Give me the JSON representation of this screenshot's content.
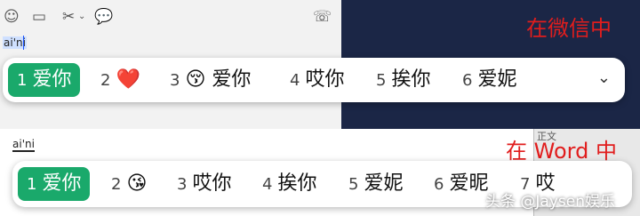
{
  "top_panel": {
    "label": "在微信中",
    "typed": "ai'ni",
    "toolbar_icons": [
      "emoji-icon",
      "folder-icon",
      "scissors-icon",
      "chat-bubble-icon",
      "phone-icon"
    ]
  },
  "ime_top": {
    "candidates": [
      {
        "num": "1",
        "text": "爱你"
      },
      {
        "num": "2",
        "text": "❤️"
      },
      {
        "num": "3",
        "text": "😚 爱你"
      },
      {
        "num": "4",
        "text": "哎你"
      },
      {
        "num": "5",
        "text": "挨你"
      },
      {
        "num": "6",
        "text": "爱妮"
      }
    ],
    "expand": "⌄"
  },
  "bottom_panel": {
    "label": "在 Word 中",
    "typed": "ai'ni",
    "side_text": "正文"
  },
  "ime_bottom": {
    "candidates": [
      {
        "num": "1",
        "text": "爱你"
      },
      {
        "num": "2",
        "text": "😘"
      },
      {
        "num": "3",
        "text": "哎你"
      },
      {
        "num": "4",
        "text": "挨你"
      },
      {
        "num": "5",
        "text": "爱妮"
      },
      {
        "num": "6",
        "text": "爱昵"
      },
      {
        "num": "7",
        "text": "哎"
      }
    ]
  },
  "watermark": "头条 @Jaysen娱乐",
  "colors": {
    "selected": "#1aa96b",
    "label": "#e11d1d",
    "dark_bg": "#1b2646"
  }
}
